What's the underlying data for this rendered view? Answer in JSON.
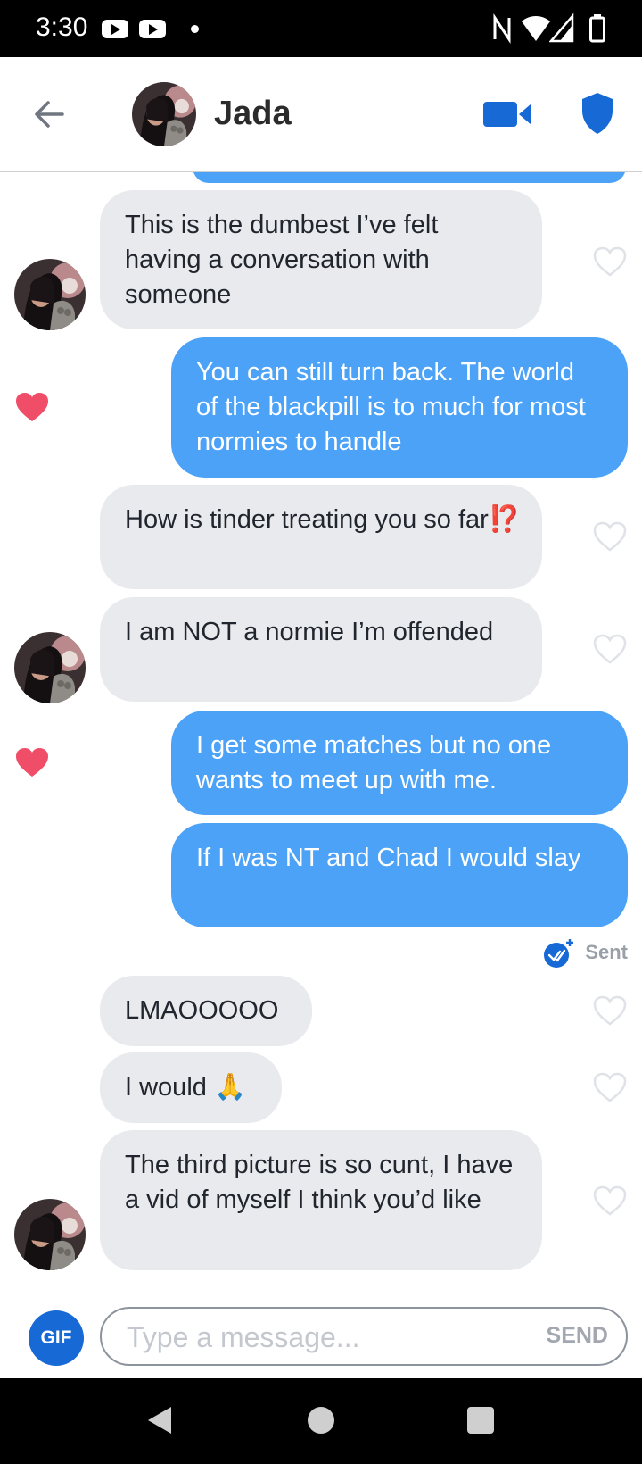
{
  "status_bar": {
    "time": "3:30",
    "notification_icons": [
      "youtube-icon",
      "youtube-icon",
      "dot"
    ],
    "system_icons": [
      "nfc-icon",
      "wifi-icon",
      "signal-icon",
      "battery-icon"
    ]
  },
  "header": {
    "name": "Jada",
    "actions": [
      "video-call-icon",
      "shield-icon"
    ]
  },
  "messages": [
    {
      "side": "in",
      "text": "This is the dumbest I’ve felt having a conversation with someone",
      "liked": false
    },
    {
      "side": "out",
      "text": "You can still turn back. The world of the blackpill is to much for most normies to handle",
      "liked": true
    },
    {
      "side": "in",
      "text": "How is tinder treating you so far",
      "emoji": "⁉️",
      "liked": false
    },
    {
      "side": "in",
      "text": "I am NOT a normie I’m offended",
      "liked": false
    },
    {
      "side": "out",
      "text": "I get some matches but no one wants to meet up with me.",
      "liked": true
    },
    {
      "side": "out",
      "text": "If I was NT and Chad I would slay",
      "liked": false
    },
    {
      "side": "in",
      "text": "LMAOOOOO",
      "liked": false
    },
    {
      "side": "in",
      "text": "I would",
      "emoji": "🙏",
      "liked": false
    },
    {
      "side": "in",
      "text": "The third picture is so cunt, I have a vid of myself I think you’d like",
      "liked": false
    }
  ],
  "sent_status": "Sent",
  "composer": {
    "gif_label": "GIF",
    "placeholder": "Type a message...",
    "send_label": "SEND"
  },
  "colors": {
    "outgoing": "#4ba2f7",
    "incoming": "#e9eaee",
    "like": "#ef4d68",
    "brand_blue": "#1769d6"
  }
}
